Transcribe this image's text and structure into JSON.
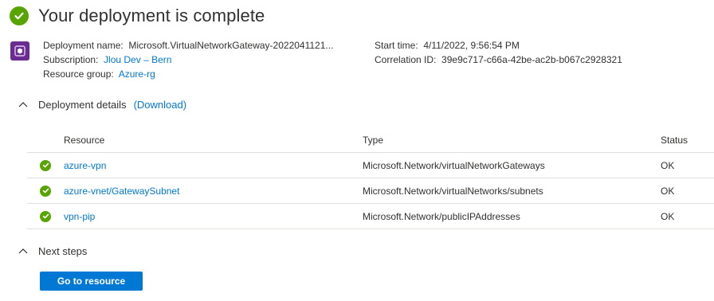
{
  "header": {
    "title": "Your deployment is complete",
    "status_icon": "check-circle-icon",
    "status_color": "#57a300"
  },
  "meta": {
    "deployment_name_label": "Deployment name:",
    "deployment_name": "Microsoft.VirtualNetworkGateway-2022041121...",
    "subscription_label": "Subscription:",
    "subscription": "Jlou Dev – Bern",
    "resource_group_label": "Resource group:",
    "resource_group": "Azure-rg",
    "start_time_label": "Start time:",
    "start_time": "4/11/2022, 9:56:54 PM",
    "correlation_id_label": "Correlation ID:",
    "correlation_id": "39e9c717-c66a-42be-ac2b-b067c2928321"
  },
  "details": {
    "label": "Deployment details",
    "download_label": "(Download)",
    "columns": {
      "resource": "Resource",
      "type": "Type",
      "status": "Status"
    },
    "rows": [
      {
        "resource": "azure-vpn",
        "type": "Microsoft.Network/virtualNetworkGateways",
        "status": "OK"
      },
      {
        "resource": "azure-vnet/GatewaySubnet",
        "type": "Microsoft.Network/virtualNetworks/subnets",
        "status": "OK"
      },
      {
        "resource": "vpn-pip",
        "type": "Microsoft.Network/publicIPAddresses",
        "status": "OK"
      }
    ]
  },
  "next_steps": {
    "label": "Next steps",
    "button_label": "Go to resource"
  },
  "colors": {
    "accent": "#0078d4",
    "success": "#57a300",
    "resource_icon": "#6b2c91"
  }
}
